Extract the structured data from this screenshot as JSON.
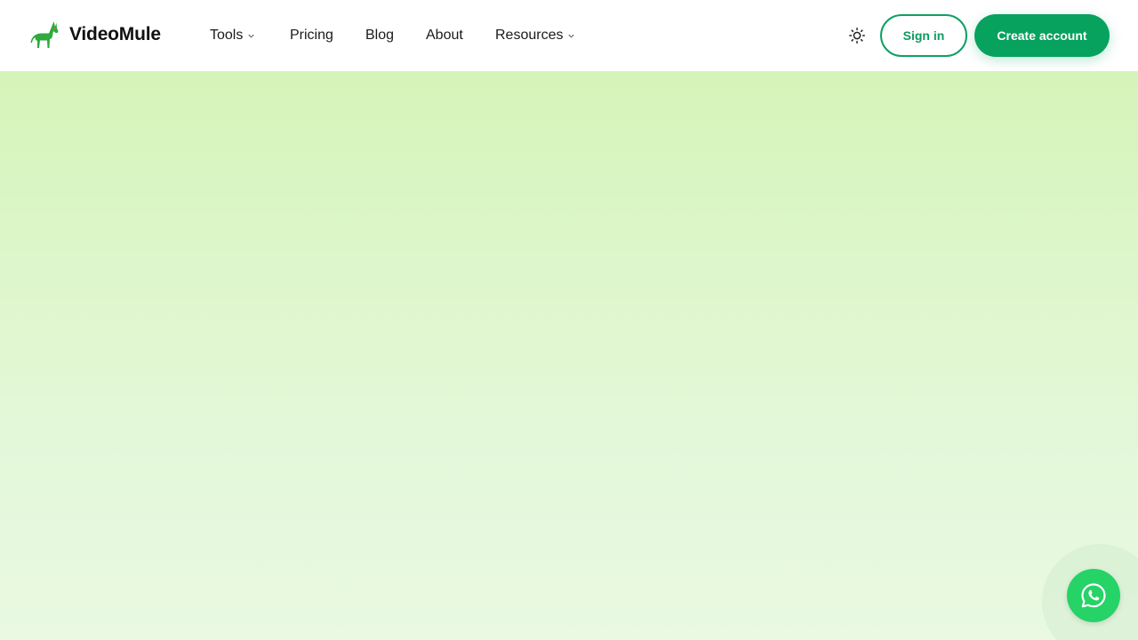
{
  "brand": {
    "name": "VideoMule",
    "logo_icon": "mule-icon",
    "logo_color": "#2eaa3f"
  },
  "nav": {
    "items": [
      {
        "label": "Tools",
        "has_dropdown": true
      },
      {
        "label": "Pricing",
        "has_dropdown": false
      },
      {
        "label": "Blog",
        "has_dropdown": false
      },
      {
        "label": "About",
        "has_dropdown": false
      },
      {
        "label": "Resources",
        "has_dropdown": true
      }
    ]
  },
  "actions": {
    "theme_icon": "sun-icon",
    "signin_label": "Sign in",
    "create_account_label": "Create account"
  },
  "chat": {
    "icon": "whatsapp-icon",
    "color": "#25d366"
  },
  "colors": {
    "accent": "#06a25e",
    "hero_top": "#d5f4b9",
    "hero_bottom": "#e9f9e2"
  }
}
